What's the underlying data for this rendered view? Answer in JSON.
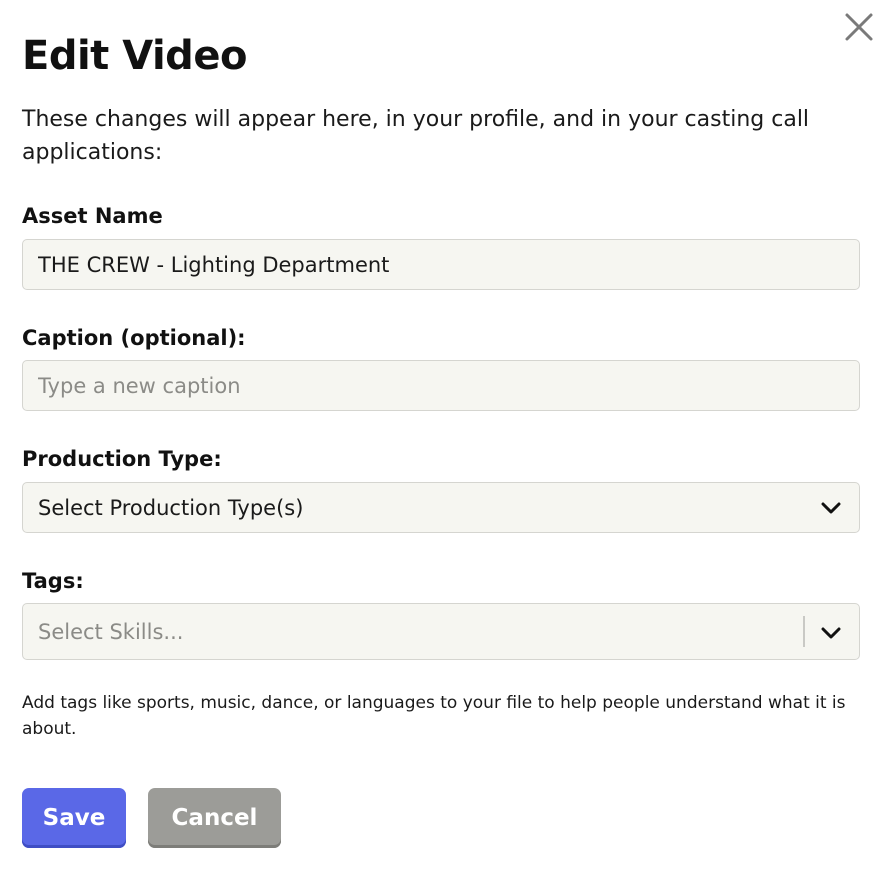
{
  "modal": {
    "title": "Edit Video",
    "intro": "These changes will appear here, in your profile, and in your casting call applications:",
    "close_icon": "close-icon"
  },
  "asset_name": {
    "label": "Asset Name",
    "value": "THE CREW - Lighting Department"
  },
  "caption": {
    "label": "Caption (optional):",
    "value": "",
    "placeholder": "Type a new caption"
  },
  "production_type": {
    "label": "Production Type:",
    "selected": "Select Production Type(s)",
    "icon": "chevron-down-icon"
  },
  "tags": {
    "label": "Tags:",
    "placeholder": "Select Skills...",
    "icon": "chevron-down-icon",
    "helper": "Add tags like sports, music, dance, or languages to your file to help people understand what it is about."
  },
  "actions": {
    "save_label": "Save",
    "cancel_label": "Cancel"
  },
  "colors": {
    "primary": "#5a68e7",
    "secondary": "#9c9c98",
    "field_background": "#f6f6f1"
  }
}
